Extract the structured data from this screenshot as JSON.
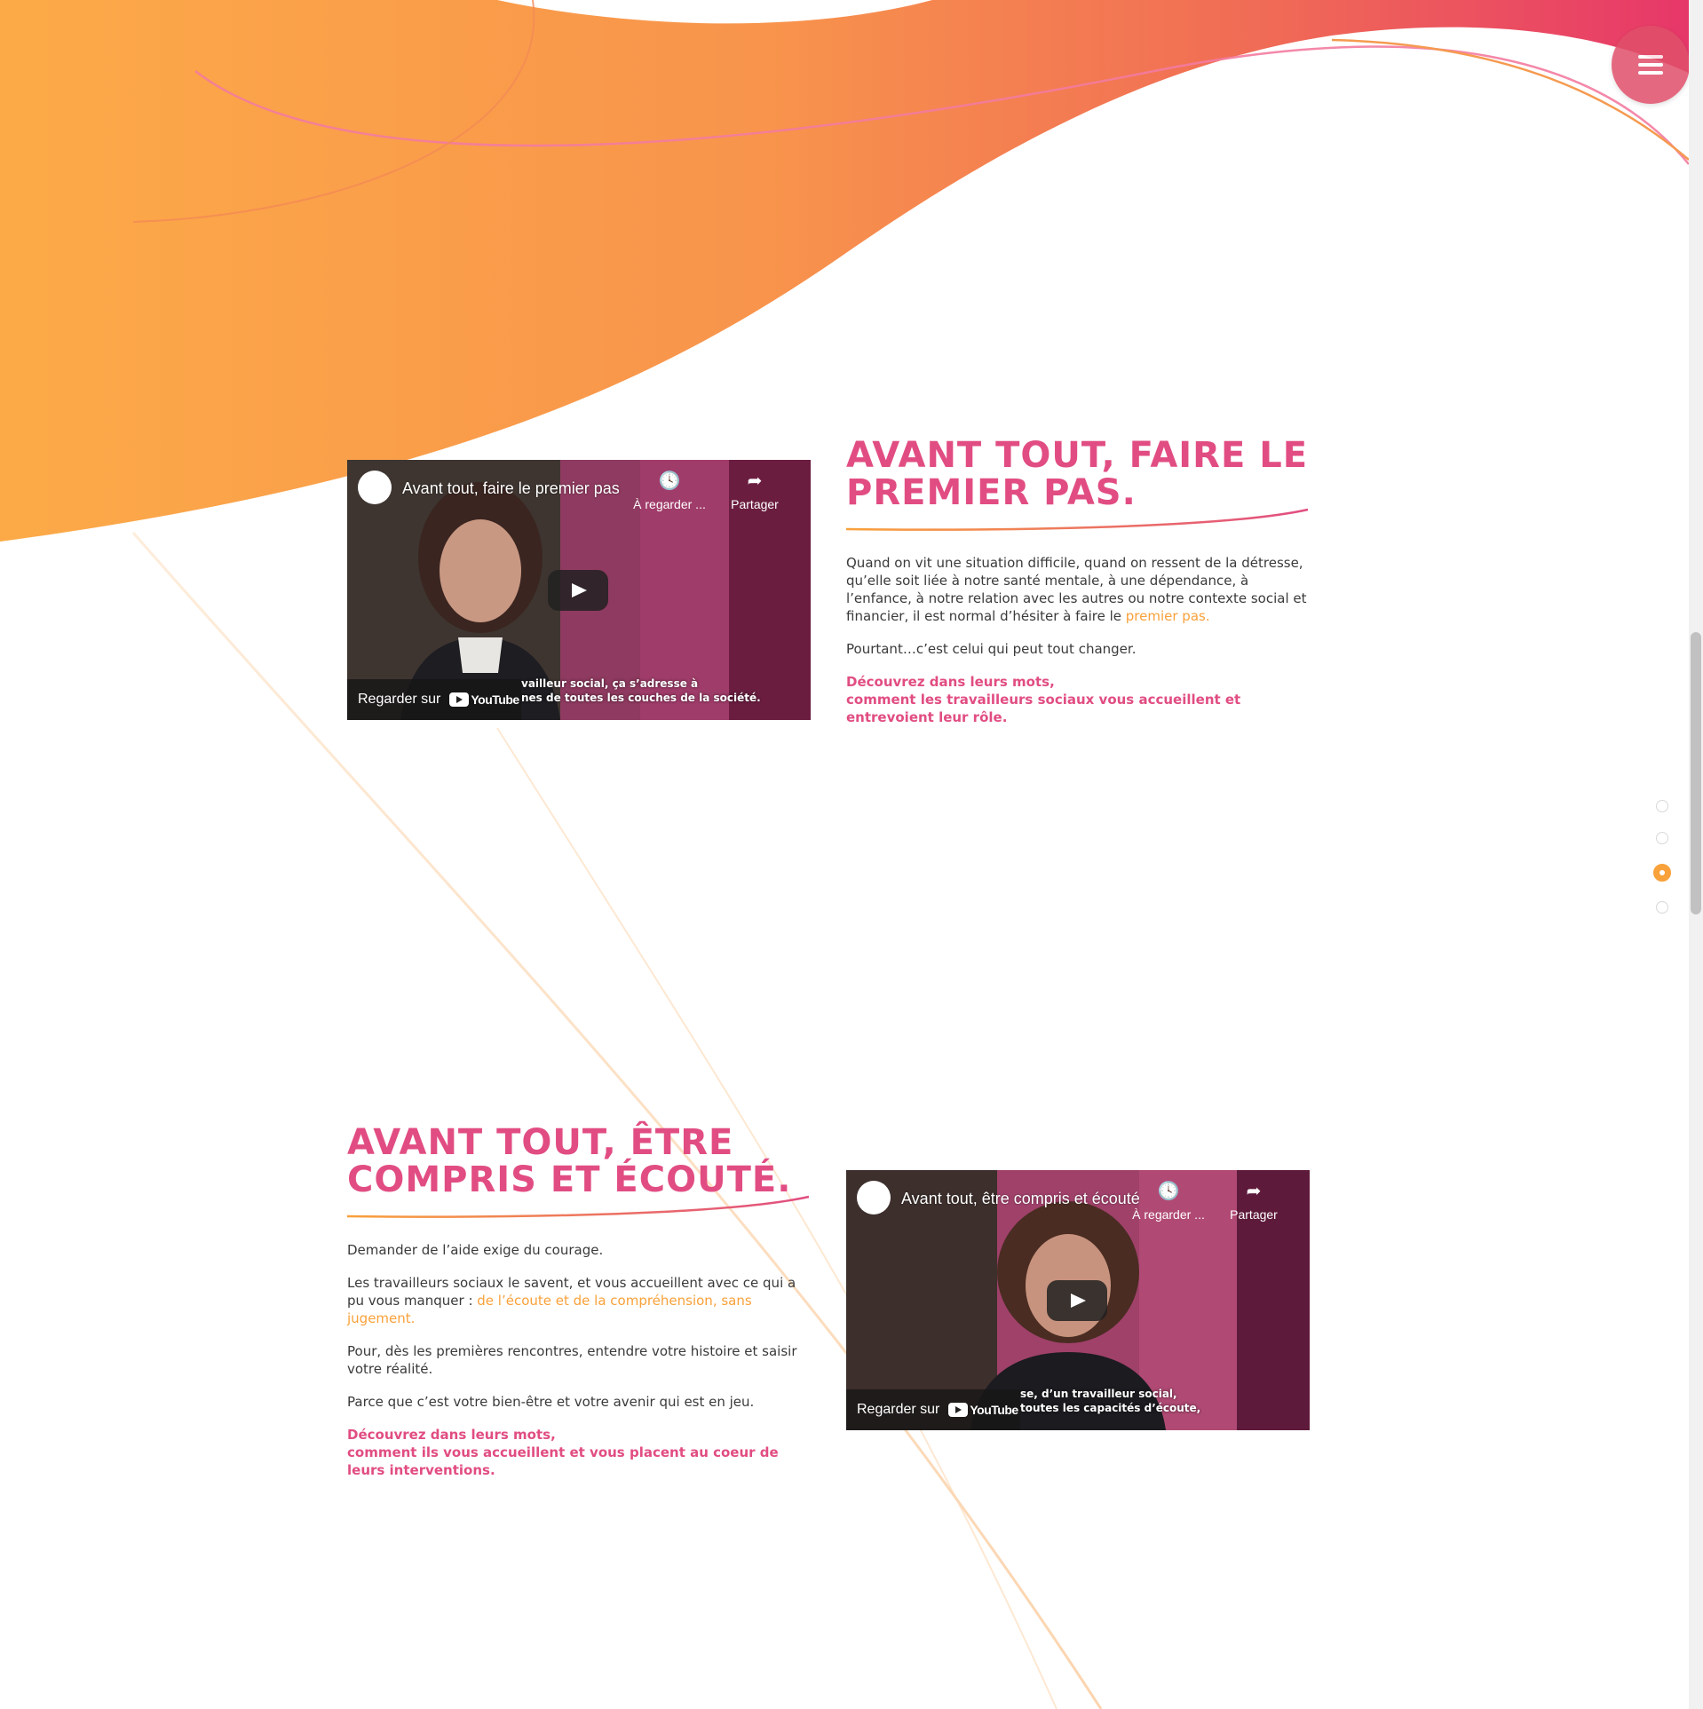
{
  "menu": {
    "icon": "hamburger-menu-icon"
  },
  "colors": {
    "orange": "#f9a13a",
    "pink": "#e14d82",
    "text": "#3a3a3a"
  },
  "nav_dots": {
    "count": 4,
    "active_index": 2
  },
  "section1": {
    "video": {
      "title": "Avant tout, faire le premier pas",
      "watch_later": "À regarder ...",
      "share": "Partager",
      "subtitle_line1": "vailleur social, ça s’adresse à",
      "subtitle_line2": "nes de toutes les couches de la société.",
      "watch_on": "Regarder sur",
      "youtube": "YouTube"
    },
    "heading_line1": "AVANT TOUT, FAIRE LE",
    "heading_line2": "PREMIER PAS.",
    "p1_text": "Quand on vit une situation difficile, quand on ressent de la détresse, qu’elle soit liée à notre santé mentale, à une dépendance, à l’enfance, à notre relation avec les autres ou notre contexte social et financier, il est normal d’hésiter à faire le ",
    "p1_highlight": "premier pas.",
    "p2": "Pourtant…c’est celui qui peut tout changer.",
    "cta_line1": "Découvrez dans leurs mots,",
    "cta_line2": "comment les travailleurs sociaux vous accueillent et entrevoient leur rôle."
  },
  "section2": {
    "heading_line1": "AVANT TOUT, ÊTRE",
    "heading_line2": "COMPRIS ET ÉCOUTÉ.",
    "p1": "Demander de l’aide exige du courage.",
    "p2_text": "Les travailleurs sociaux le savent, et vous accueillent avec ce qui a pu vous manquer : ",
    "p2_highlight": "de l’écoute et de la compréhension, sans jugement.",
    "p3": "Pour, dès les premières rencontres, entendre votre histoire et saisir votre réalité.",
    "p4": "Parce que c’est votre bien-être et votre avenir qui est en jeu.",
    "cta_line1": "Découvrez dans leurs mots,",
    "cta_line2": "comment ils vous accueillent et vous placent au coeur de leurs interventions.",
    "video": {
      "title": "Avant tout, être compris et écouté",
      "watch_later": "À regarder ...",
      "share": "Partager",
      "subtitle_line1": "se, d’un travailleur social,",
      "subtitle_line2": "toutes les capacités d’écoute,",
      "watch_on": "Regarder sur",
      "youtube": "YouTube"
    }
  }
}
